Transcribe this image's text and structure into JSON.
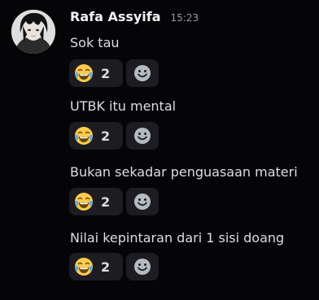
{
  "user": {
    "name": "Rafa Assyifa",
    "timestamp": "15:23"
  },
  "messages": [
    {
      "text": "Sok tau",
      "reaction": {
        "emoji": "joy-emoji",
        "count": "2"
      }
    },
    {
      "text": "UTBK itu mental",
      "reaction": {
        "emoji": "joy-emoji",
        "count": "2"
      }
    },
    {
      "text": "Bukan sekadar penguasaan materi",
      "reaction": {
        "emoji": "joy-emoji",
        "count": "2"
      }
    },
    {
      "text": "Nilai kepintaran dari 1 sisi doang",
      "reaction": {
        "emoji": "joy-emoji",
        "count": "2"
      }
    }
  ],
  "colors": {
    "background": "#050507",
    "reaction_bg": "#1c1c21",
    "username": "#f2f3f5",
    "timestamp": "#949ba4",
    "text": "#dbdee1"
  }
}
